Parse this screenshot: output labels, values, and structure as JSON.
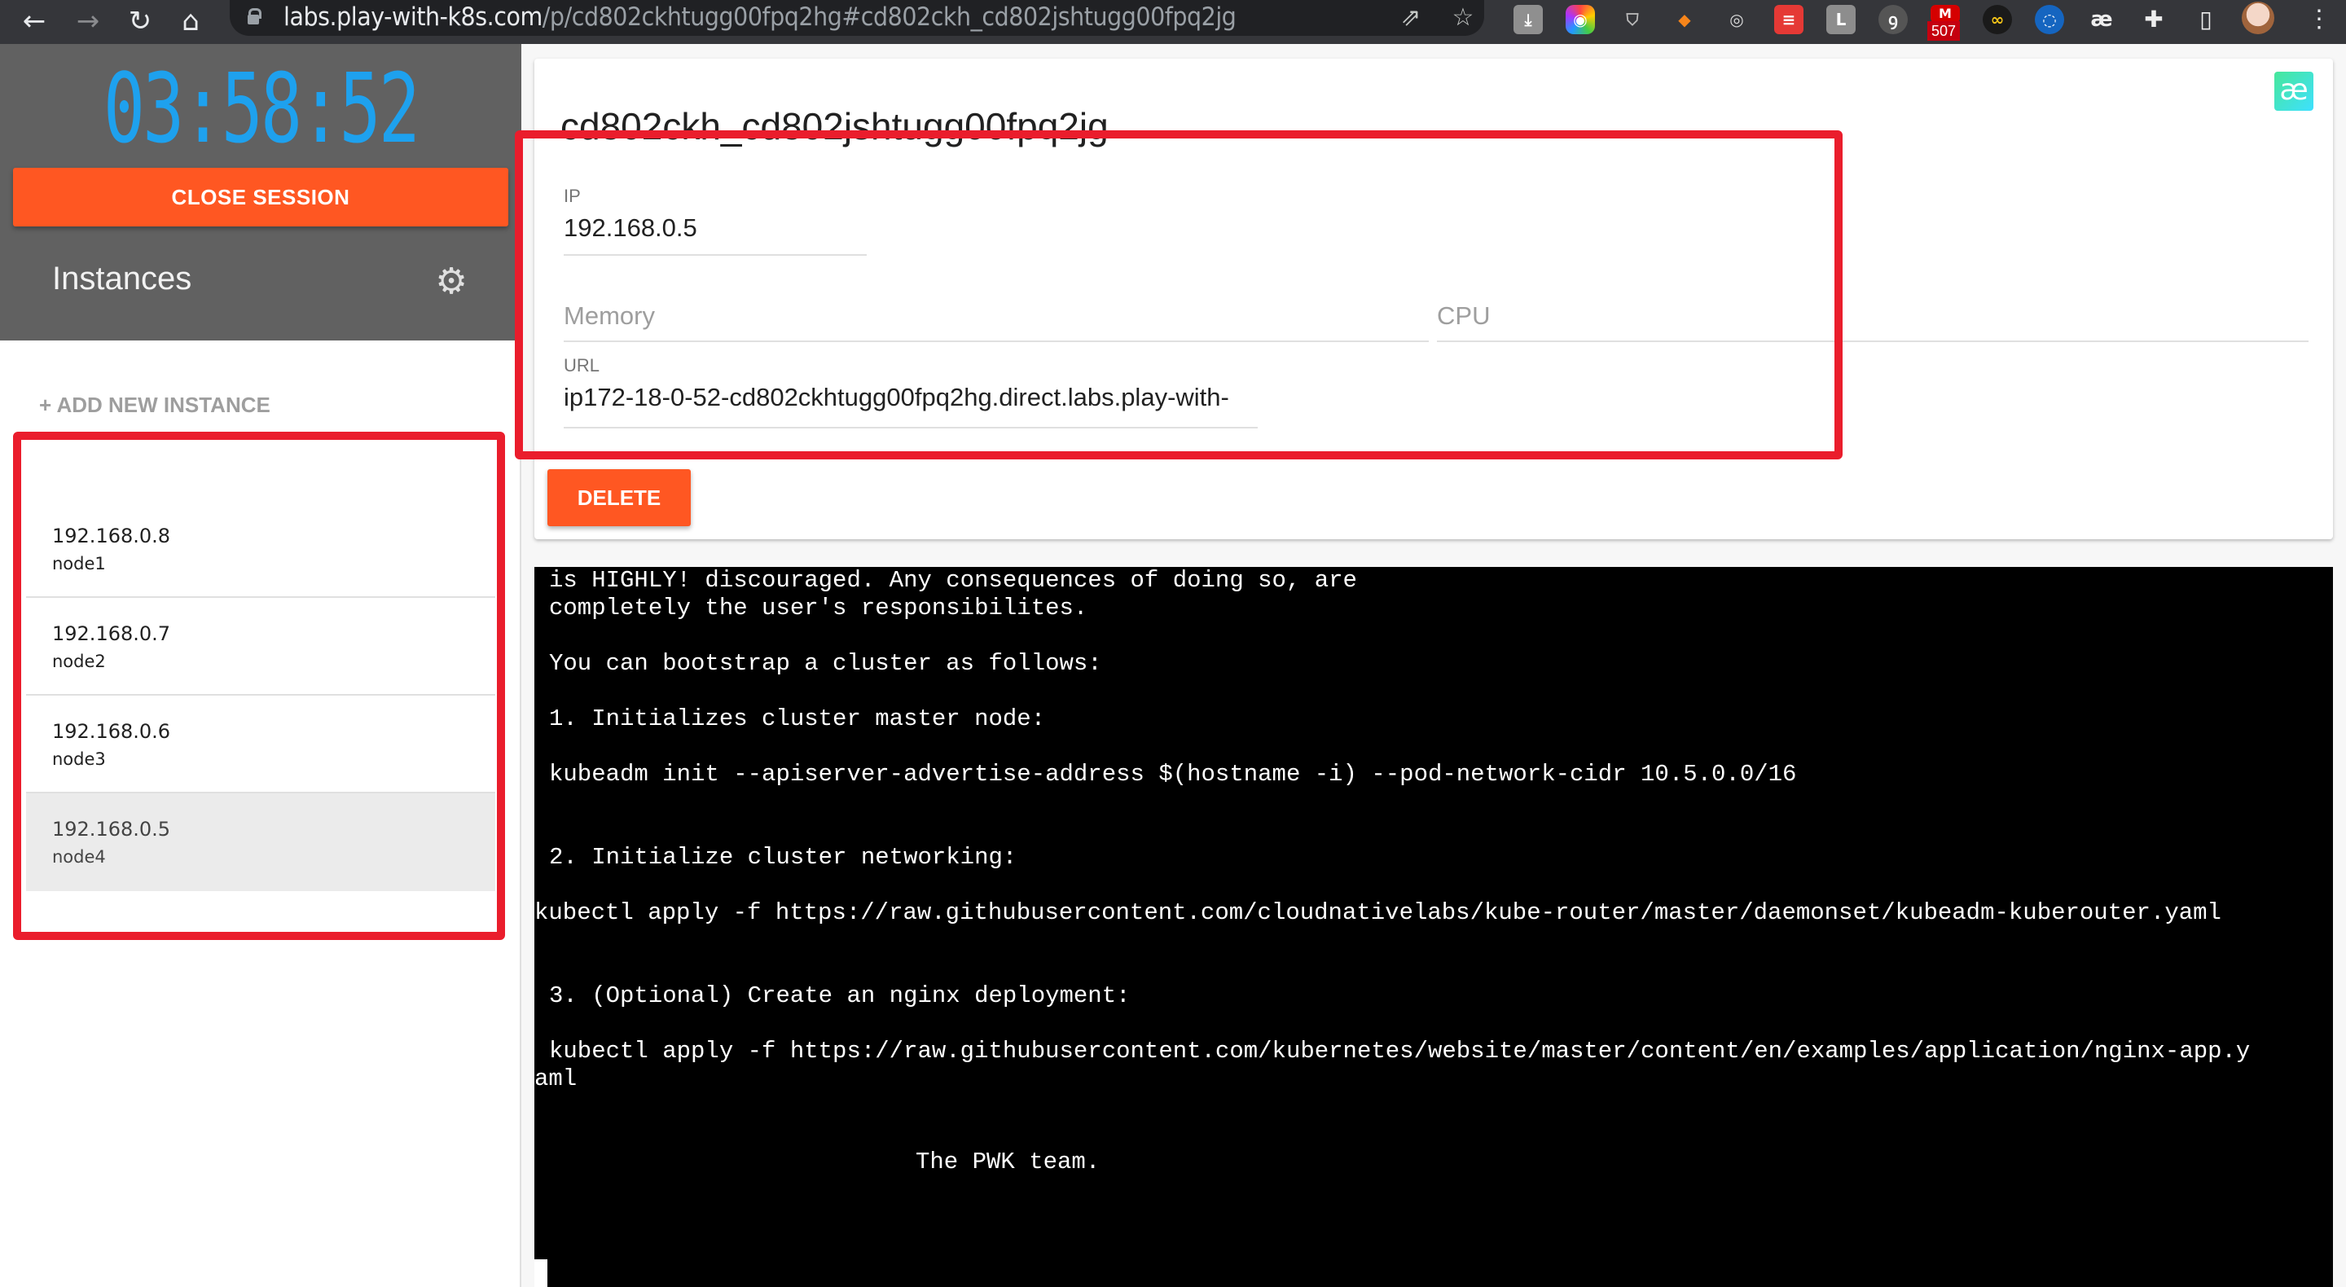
{
  "browser": {
    "url_host": "labs.play-with-k8s.com",
    "url_path": "/p/cd802ckhtugg00fpq2hg#cd802ckh_cd802jshtugg00fpq2jg",
    "extension_badge": "507",
    "icons": [
      "back-icon",
      "forward-icon",
      "reload-icon",
      "home-icon",
      "lock-icon",
      "share-icon",
      "star-icon"
    ]
  },
  "sidebar": {
    "timer": "03:58:52",
    "close_session_label": "CLOSE SESSION",
    "instances_title": "Instances",
    "add_instance_label": "+ ADD NEW INSTANCE",
    "instances": [
      {
        "ip": "192.168.0.8",
        "hostname": "node1",
        "active": false
      },
      {
        "ip": "192.168.0.7",
        "hostname": "node2",
        "active": false
      },
      {
        "ip": "192.168.0.6",
        "hostname": "node3",
        "active": false
      },
      {
        "ip": "192.168.0.5",
        "hostname": "node4",
        "active": true
      }
    ]
  },
  "instance_card": {
    "title": "cd802ckh_cd802jshtugg00fpq2jg",
    "logo_glyph": "æ",
    "ip_label": "IP",
    "ip_value": "192.168.0.5",
    "memory_placeholder": "Memory",
    "cpu_placeholder": "CPU",
    "url_label": "URL",
    "url_value": "ip172-18-0-52-cd802ckhtugg00fpq2hg.direct.labs.play-with-",
    "delete_label": "DELETE"
  },
  "terminal": {
    "lines": [
      "is HIGHLY! discouraged. Any consequences of doing so, are",
      "completely the user's responsibilites.",
      "You can bootstrap a cluster as follows:",
      "1. Initializes cluster master node:",
      "kubeadm init --apiserver-advertise-address $(hostname -i) --pod-network-cidr 10.5.0.0/16",
      "2. Initialize cluster networking:",
      "kubectl apply -f https://raw.githubusercontent.com/cloudnativelabs/kube-router/master/daemonset/kubeadm-kuberouter.yaml",
      "3. (Optional) Create an nginx deployment:",
      "kubectl apply -f https://raw.githubusercontent.com/kubernetes/website/master/content/en/examples/application/nginx-app.y",
      "aml",
      "The PWK team."
    ]
  }
}
